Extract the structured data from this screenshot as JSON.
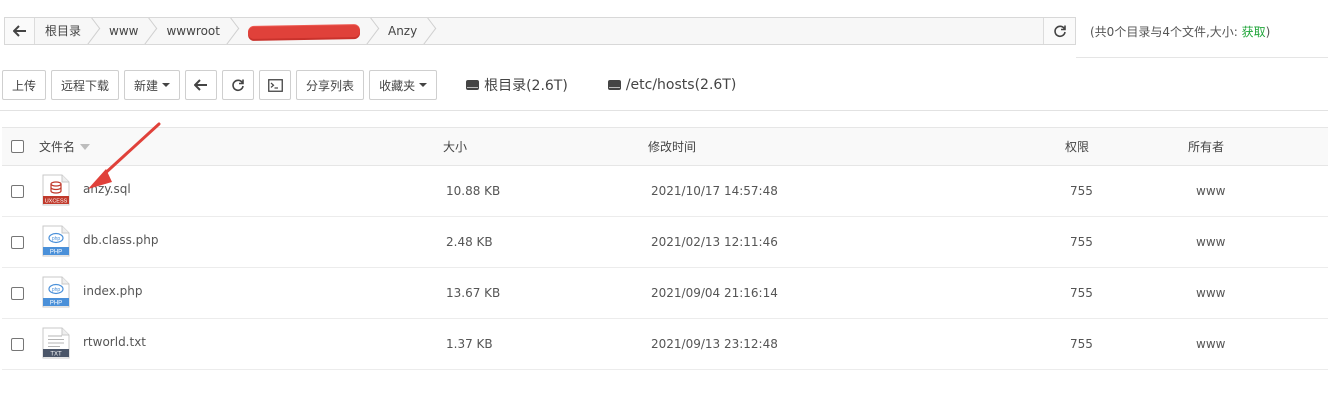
{
  "address_bar": {
    "crumbs": [
      "根目录",
      "www",
      "wwwroot",
      "",
      "Anzy"
    ]
  },
  "summary": {
    "prefix": "(共0个目录与4个文件,大小: ",
    "link": "获取",
    "suffix": ")"
  },
  "toolbar": {
    "upload": "上传",
    "remote_download": "远程下载",
    "new": "新建",
    "share_list": "分享列表",
    "favorites": "收藏夹",
    "disks": [
      "根目录(2.6T)",
      "/etc/hosts(2.6T)"
    ]
  },
  "table": {
    "headers": {
      "name": "文件名",
      "size": "大小",
      "mtime": "修改时间",
      "perm": "权限",
      "owner": "所有者"
    },
    "rows": [
      {
        "name": "anzy.sql",
        "size": "10.88 KB",
        "mtime": "2021/10/17 14:57:48",
        "perm": "755",
        "owner": "www",
        "icon": "sql-file-icon",
        "icon_label": "UXCESS"
      },
      {
        "name": "db.class.php",
        "size": "2.48 KB",
        "mtime": "2021/02/13 12:11:46",
        "perm": "755",
        "owner": "www",
        "icon": "php-file-icon",
        "icon_label": "PHP"
      },
      {
        "name": "index.php",
        "size": "13.67 KB",
        "mtime": "2021/09/04 21:16:14",
        "perm": "755",
        "owner": "www",
        "icon": "php-file-icon",
        "icon_label": "PHP"
      },
      {
        "name": "rtworld.txt",
        "size": "1.37 KB",
        "mtime": "2021/09/13 23:12:48",
        "perm": "755",
        "owner": "www",
        "icon": "txt-file-icon",
        "icon_label": "TXT"
      }
    ]
  },
  "colors": {
    "accent_green": "#20a53a",
    "annotation_red": "#e0413a",
    "php_blue": "#4a90d9",
    "sql_red": "#c0392b",
    "txt_dark": "#4a5568"
  }
}
